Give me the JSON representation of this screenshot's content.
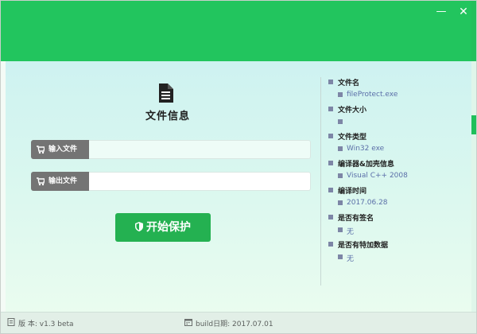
{
  "window": {
    "controls": {
      "minimize": "—",
      "close": "✕"
    }
  },
  "main": {
    "section_title": "文件信息",
    "input_file": {
      "label": "输入文件",
      "value": ""
    },
    "output_file": {
      "label": "输出文件",
      "value": ""
    },
    "start_button": "开始保护",
    "icons": {
      "document": "document-icon",
      "input_label": "cart-icon",
      "output_label": "cart-icon",
      "start_button": "shield-icon"
    }
  },
  "info_panel": {
    "items": [
      {
        "label": "文件名",
        "value": "fileProtect.exe"
      },
      {
        "label": "文件大小",
        "value": ""
      },
      {
        "label": "文件类型",
        "value": "Win32 exe"
      },
      {
        "label": "编译器&加壳信息",
        "value": "Visual C++ 2008"
      },
      {
        "label": "编译时间",
        "value": "2017.06.28"
      },
      {
        "label": "是否有签名",
        "value": "无"
      },
      {
        "label": "是否有特加数据",
        "value": "无"
      }
    ]
  },
  "status_bar": {
    "version": "版 本: v1.3 beta",
    "build_date": "build日期: 2017.07.01",
    "icons": {
      "version": "document-icon",
      "build_date": "calendar-icon"
    }
  },
  "colors": {
    "titlebar": "#22c55e",
    "start_button": "#24b151",
    "label_box": "#747474",
    "value_text": "#5b6fa8"
  }
}
